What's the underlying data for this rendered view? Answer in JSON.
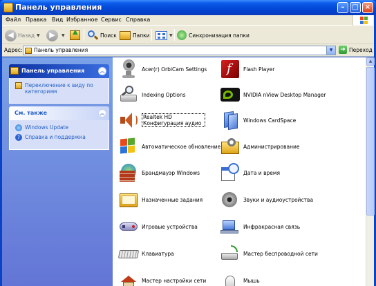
{
  "window": {
    "title": "Панель управления"
  },
  "menu": [
    "Файл",
    "Правка",
    "Вид",
    "Избранное",
    "Сервис",
    "Справка"
  ],
  "toolbar": {
    "back": "Назад",
    "search": "Поиск",
    "folders": "Папки",
    "sync": "Синхронизация папки"
  },
  "address": {
    "label": "Адрес:",
    "value": "Панель управления",
    "go": "Переход"
  },
  "sidebar": {
    "panel1": {
      "title": "Панель управления",
      "links": [
        "Переключение к виду по категориям"
      ]
    },
    "panel2": {
      "title": "См. также",
      "links": [
        "Windows Update",
        "Справка и поддержка"
      ]
    }
  },
  "items": [
    {
      "label": "Acer(r) OrbiCam Settings",
      "icon": "webcam-icon"
    },
    {
      "label": "Flash Player",
      "icon": "flash-player-icon"
    },
    {
      "label": "Indexing Options",
      "icon": "indexing-options-icon"
    },
    {
      "label": "NVIDIA nView Desktop Manager",
      "icon": "nvidia-icon"
    },
    {
      "label": "Realtek HD Конфигурация аудио",
      "icon": "speaker-icon"
    },
    {
      "label": "Windows CardSpace",
      "icon": "cardspace-icon"
    },
    {
      "label": "Автоматическое обновление",
      "icon": "windows-update-icon"
    },
    {
      "label": "Администрирование",
      "icon": "admin-tools-icon"
    },
    {
      "label": "Брандмауэр Windows",
      "icon": "firewall-icon"
    },
    {
      "label": "Дата и время",
      "icon": "date-time-icon"
    },
    {
      "label": "Назначенные задания",
      "icon": "scheduled-tasks-icon"
    },
    {
      "label": "Звуки и аудиоустройства",
      "icon": "sounds-icon"
    },
    {
      "label": "Игровые устройства",
      "icon": "game-controller-icon"
    },
    {
      "label": "Инфракрасная связь",
      "icon": "infrared-icon"
    },
    {
      "label": "Клавиатура",
      "icon": "keyboard-icon"
    },
    {
      "label": "Мастер беспроводной сети",
      "icon": "wireless-icon"
    },
    {
      "label": "Мастер настройки сети",
      "icon": "network-setup-icon"
    },
    {
      "label": "Мышь",
      "icon": "mouse-icon"
    }
  ]
}
